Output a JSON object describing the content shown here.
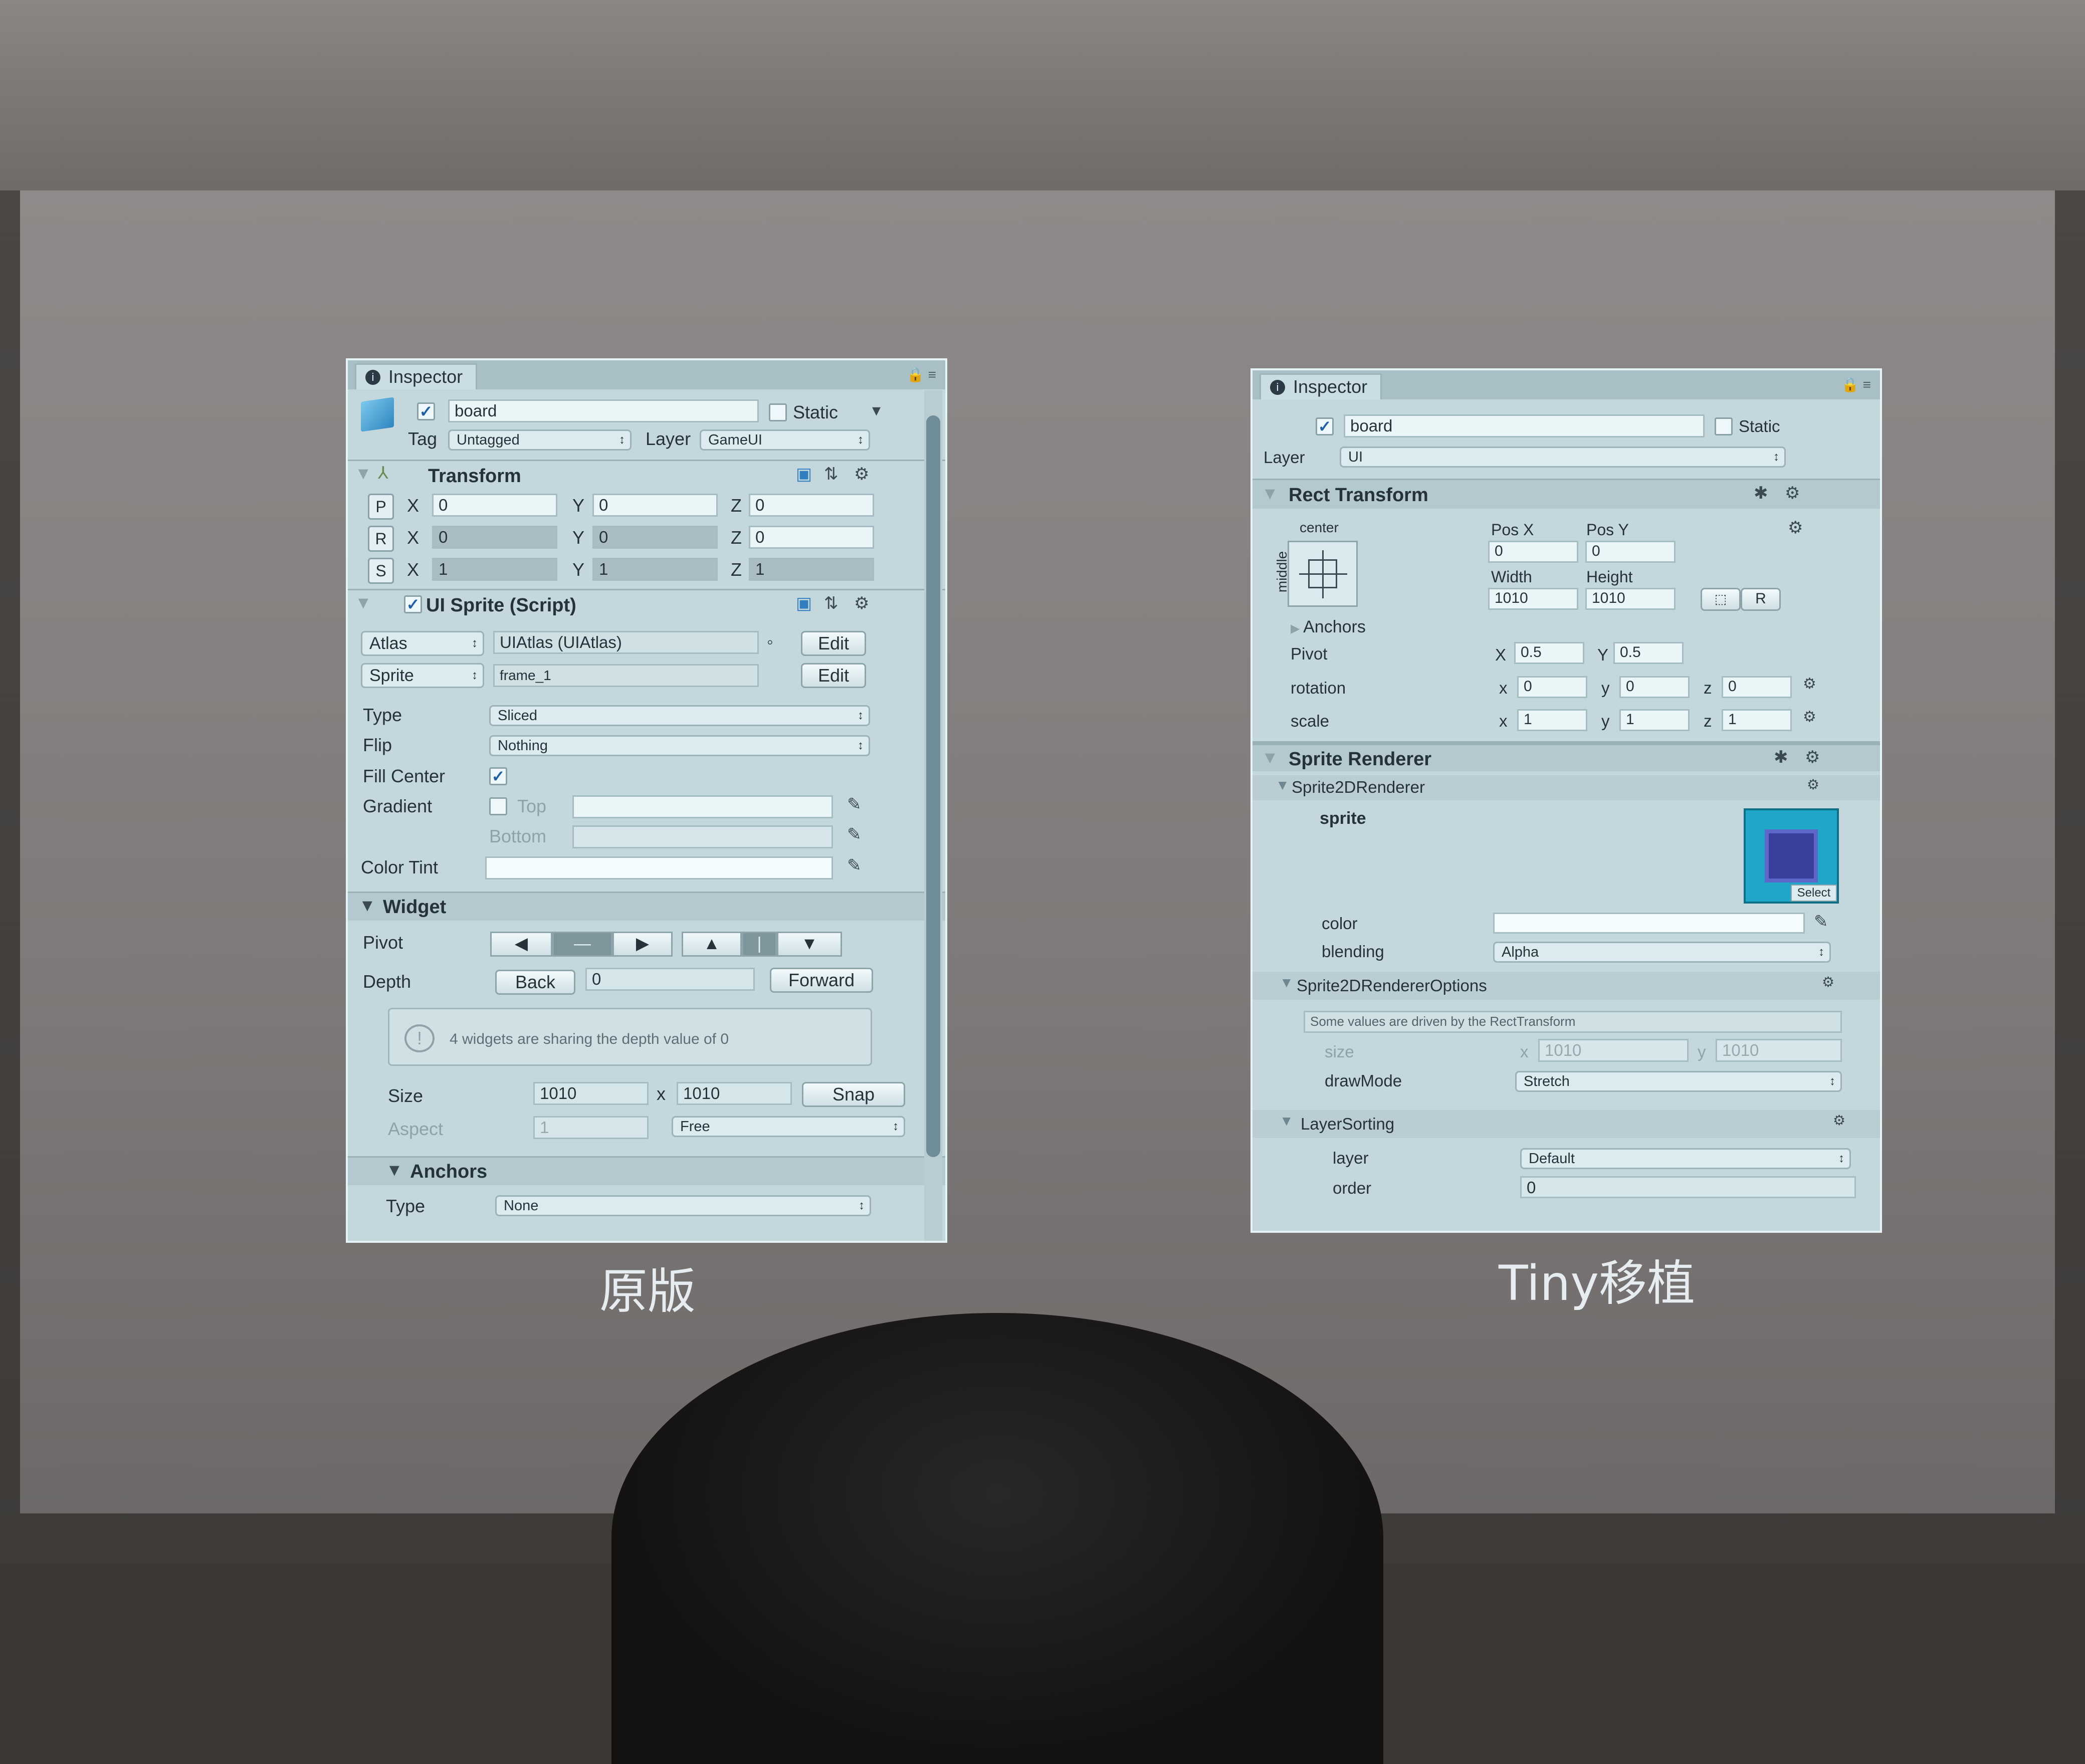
{
  "left_inspector": {
    "tab_title": "Inspector",
    "object_name": "board",
    "static_label": "Static",
    "tag_label": "Tag",
    "tag_value": "Untagged",
    "layer_label": "Layer",
    "layer_value": "GameUI",
    "transform": {
      "title": "Transform",
      "rows": [
        {
          "btn": "P",
          "x": "0",
          "y": "0",
          "z": "0"
        },
        {
          "btn": "R",
          "x": "0",
          "y": "0",
          "z": "0"
        },
        {
          "btn": "S",
          "x": "1",
          "y": "1",
          "z": "1"
        }
      ],
      "x_label": "X",
      "y_label": "Y",
      "z_label": "Z"
    },
    "ui_sprite": {
      "title": "UI Sprite (Script)",
      "atlas_label": "Atlas",
      "atlas_value": "UIAtlas (UIAtlas)",
      "sprite_label": "Sprite",
      "sprite_value": "frame_1",
      "edit_label": "Edit",
      "type_label": "Type",
      "type_value": "Sliced",
      "flip_label": "Flip",
      "flip_value": "Nothing",
      "fill_center_label": "Fill Center",
      "gradient_label": "Gradient",
      "top_label": "Top",
      "bottom_label": "Bottom",
      "color_tint_label": "Color Tint"
    },
    "widget": {
      "title": "Widget",
      "pivot_label": "Pivot",
      "pivot_buttons": [
        "◀",
        "—",
        "▶",
        "▲",
        "|",
        "▼"
      ],
      "depth_label": "Depth",
      "back_label": "Back",
      "depth_value": "0",
      "forward_label": "Forward",
      "warning": "4 widgets are sharing the depth value of 0",
      "size_label": "Size",
      "width": "1010",
      "x_sep": "x",
      "height": "1010",
      "snap_label": "Snap",
      "aspect_label": "Aspect",
      "aspect_value": "1",
      "aspect_mode": "Free"
    },
    "anchors": {
      "title": "Anchors",
      "type_label": "Type",
      "type_value": "None"
    }
  },
  "right_inspector": {
    "tab_title": "Inspector",
    "object_name": "board",
    "static_label": "Static",
    "layer_label": "Layer",
    "layer_value": "UI",
    "rect_transform": {
      "title": "Rect Transform",
      "anchor_h": "center",
      "anchor_v": "middle",
      "pos_x_label": "Pos X",
      "pos_y_label": "Pos Y",
      "pos_x": "0",
      "pos_y": "0",
      "width_label": "Width",
      "height_label": "Height",
      "width": "1010",
      "height": "1010",
      "r_button": "R",
      "anchors_label": "Anchors",
      "pivot_label": "Pivot",
      "pivot_x_label": "X",
      "pivot_x": "0.5",
      "pivot_y_label": "Y",
      "pivot_y": "0.5",
      "rotation_label": "rotation",
      "rotation": {
        "x": "0",
        "y": "0",
        "z": "0"
      },
      "scale_label": "scale",
      "scale": {
        "x": "1",
        "y": "1",
        "z": "1"
      },
      "lx": "x",
      "ly": "y",
      "lz": "z"
    },
    "sprite_renderer": {
      "title": "Sprite Renderer",
      "sub1": "Sprite2DRenderer",
      "sprite_label": "sprite",
      "select_label": "Select",
      "color_label": "color",
      "blending_label": "blending",
      "blending_value": "Alpha",
      "sub2": "Sprite2DRendererOptions",
      "note": "Some values are driven by the RectTransform",
      "size_label": "size",
      "size_x_label": "x",
      "size_x": "1010",
      "size_y_label": "y",
      "size_y": "1010",
      "drawmode_label": "drawMode",
      "drawmode_value": "Stretch",
      "sub3": "LayerSorting",
      "layer_label": "layer",
      "layer_value": "Default",
      "order_label": "order",
      "order_value": "0"
    }
  },
  "captions": {
    "left": "原版",
    "right": "Tiny移植"
  }
}
